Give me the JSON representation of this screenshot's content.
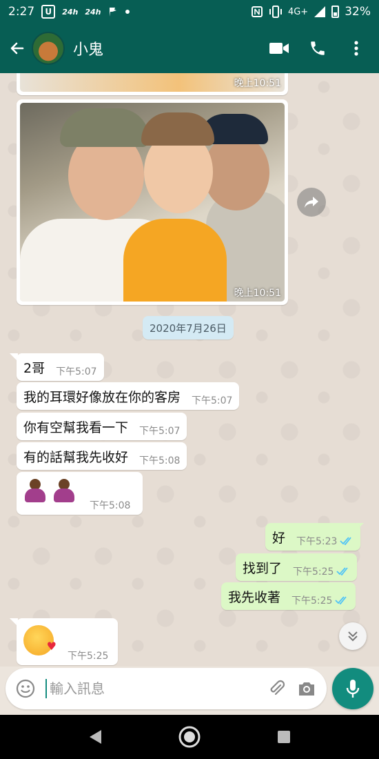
{
  "status_bar": {
    "time": "2:27",
    "icon_u": "U",
    "chip1": "24h",
    "chip2": "24h",
    "network": "4G+",
    "battery": "32%"
  },
  "header": {
    "contact_name": "小鬼",
    "icons": [
      "back-arrow-icon",
      "video-call-icon",
      "phone-icon",
      "more-vert-icon"
    ]
  },
  "chat": {
    "images": [
      {
        "time": "晚上10:51"
      },
      {
        "time": "晚上10:51"
      }
    ],
    "date_chip": "2020年7月26日",
    "messages": [
      {
        "dir": "in",
        "text": "2哥",
        "time": "下午5:07"
      },
      {
        "dir": "in",
        "text": "我的耳環好像放在你的客房",
        "time": "下午5:07"
      },
      {
        "dir": "in",
        "text": "你有空幫我看一下",
        "time": "下午5:07"
      },
      {
        "dir": "in",
        "text": "有的話幫我先收好",
        "time": "下午5:08"
      },
      {
        "dir": "in",
        "emoji": "person-bowing x2",
        "time": "下午5:08"
      },
      {
        "dir": "out",
        "text": "好",
        "time": "下午5:23",
        "status": "read"
      },
      {
        "dir": "out",
        "text": "找到了",
        "time": "下午5:25",
        "status": "read"
      },
      {
        "dir": "out",
        "text": "我先收著",
        "time": "下午5:25",
        "status": "read"
      },
      {
        "dir": "in",
        "emoji": "face-blowing-kiss",
        "time": "下午5:25"
      }
    ]
  },
  "input": {
    "placeholder": "輸入訊息"
  },
  "colors": {
    "header": "#075e54",
    "accent": "#128c7e",
    "outgoing_bubble": "#dcf8c6",
    "read_ticks": "#4fc3f7"
  }
}
